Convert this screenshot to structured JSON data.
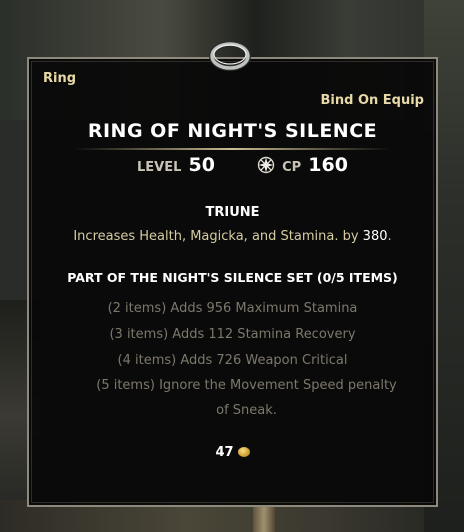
{
  "tooltip": {
    "item_type": "Ring",
    "bind_type": "Bind On Equip",
    "name": "RING OF NIGHT'S SILENCE",
    "level_label": "LEVEL",
    "level_value": "50",
    "cp_label": "CP",
    "cp_value": "160",
    "trait": {
      "name": "TRIUNE",
      "description_prefix": "Increases Health, Magicka, and Stamina. by ",
      "description_value": "380",
      "description_suffix": "."
    },
    "set": {
      "title": "PART OF THE NIGHT'S SILENCE SET (0/5 ITEMS)",
      "bonuses": [
        "(2 items) Adds 956 Maximum Stamina",
        "(3 items) Adds 112 Stamina Recovery",
        "(4 items) Adds 726 Weapon Critical",
        "(5 items) Ignore the Movement Speed penalty of Sneak."
      ]
    },
    "price": "47"
  },
  "icons": {
    "item": "ring-icon",
    "cp": "champion-points-icon",
    "currency": "gold-coin-icon"
  },
  "colors": {
    "panel_background": "#080808",
    "panel_border": "#8d8a7d",
    "header_text": "#e8d9a6",
    "trait_text": "#d6cba2",
    "inactive_set_text": "#7d786c"
  }
}
